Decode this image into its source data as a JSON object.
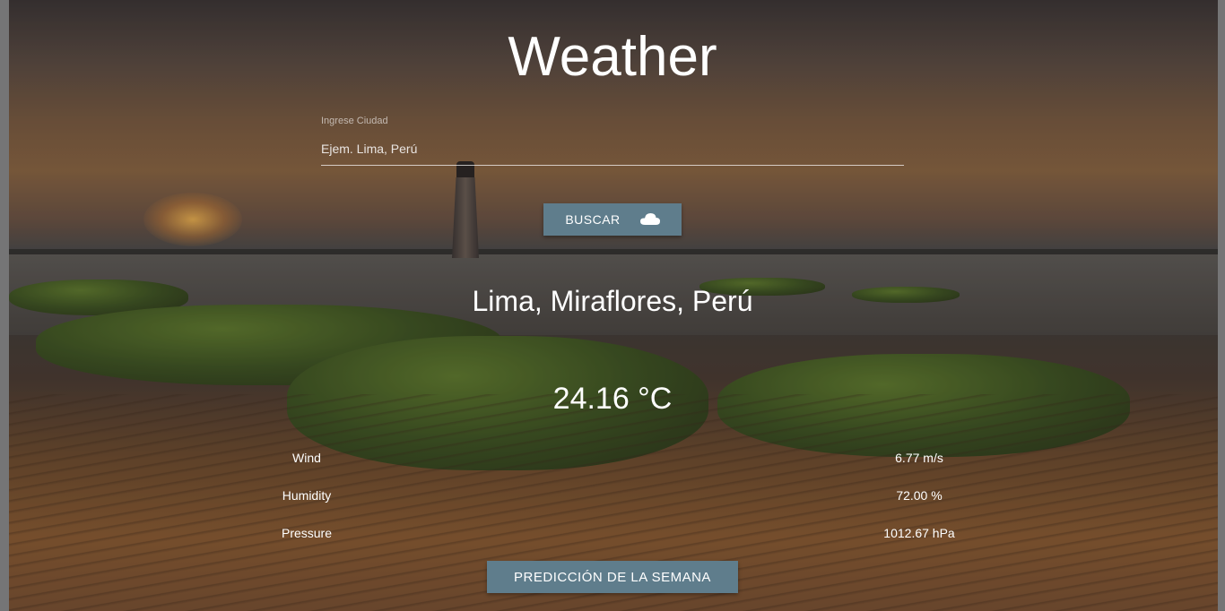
{
  "title": "Weather",
  "search": {
    "label": "Ingrese Ciudad",
    "placeholder": "Ejem. Lima, Perú",
    "value": "",
    "button_label": "BUSCAR",
    "button_icon": "cloud-icon"
  },
  "location": "Lima, Miraflores, Perú",
  "temperature": "24.16 °C",
  "details": [
    {
      "label": "Wind",
      "value": "6.77 m/s"
    },
    {
      "label": "Humidity",
      "value": "72.00 %"
    },
    {
      "label": "Pressure",
      "value": "1012.67 hPa"
    }
  ],
  "forecast_button": "PREDICCIÓN DE LA SEMANA",
  "colors": {
    "button": "#5f7d8c",
    "text": "#ffffff"
  }
}
